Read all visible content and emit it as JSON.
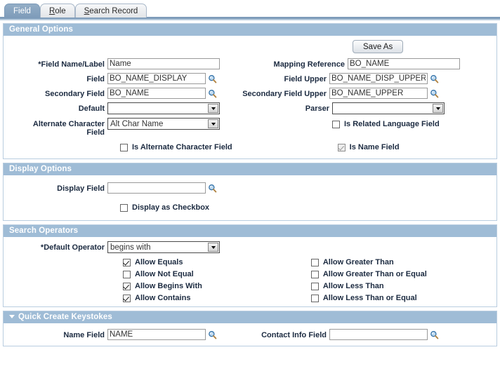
{
  "tabs": [
    {
      "label": "Field",
      "accesskey": "",
      "active": true
    },
    {
      "label": "Role",
      "accesskey": "R",
      "active": false
    },
    {
      "label": "Search Record",
      "accesskey": "S",
      "active": false
    }
  ],
  "general_options": {
    "title": "General Options",
    "save_as_button": "Save As",
    "left": {
      "field_name_label": {
        "label": "*Field Name/Label",
        "value": "Name"
      },
      "field": {
        "label": "Field",
        "value": "BO_NAME_DISPLAY",
        "icon": "magnifier-icon"
      },
      "secondary_field": {
        "label": "Secondary Field",
        "value": "BO_NAME",
        "icon": "magnifier-icon"
      },
      "default": {
        "label": "Default",
        "value": ""
      },
      "alternate_character_field": {
        "label_line1": "Alternate Character",
        "label_line2": "Field",
        "value": "Alt Char Name"
      },
      "is_alternate_character_field": {
        "label": "Is Alternate Character Field",
        "checked": false,
        "disabled": false
      }
    },
    "right": {
      "mapping_reference": {
        "label": "Mapping Reference",
        "value": "BO_NAME"
      },
      "field_upper": {
        "label": "Field Upper",
        "value": "BO_NAME_DISP_UPPER",
        "icon": "magnifier-icon"
      },
      "secondary_field_upper": {
        "label": "Secondary Field Upper",
        "value": "BO_NAME_UPPER",
        "icon": "magnifier-icon"
      },
      "parser": {
        "label": "Parser",
        "value": ""
      },
      "is_related_language_field": {
        "label": "Is Related Language Field",
        "checked": false,
        "disabled": false
      },
      "is_name_field": {
        "label": "Is Name Field",
        "checked": true,
        "disabled": true
      }
    }
  },
  "display_options": {
    "title": "Display Options",
    "display_field": {
      "label": "Display Field",
      "value": "",
      "icon": "magnifier-icon"
    },
    "display_as_checkbox": {
      "label": "Display as Checkbox",
      "checked": false
    }
  },
  "search_operators": {
    "title": "Search Operators",
    "default_operator": {
      "label": "*Default Operator",
      "value": "begins with"
    },
    "left_checkboxes": [
      {
        "label": "Allow Equals",
        "checked": true
      },
      {
        "label": "Allow Not Equal",
        "checked": false
      },
      {
        "label": "Allow Begins With",
        "checked": true
      },
      {
        "label": "Allow Contains",
        "checked": true
      }
    ],
    "right_checkboxes": [
      {
        "label": "Allow Greater Than",
        "checked": false
      },
      {
        "label": "Allow Greater Than or Equal",
        "checked": false
      },
      {
        "label": "Allow Less Than",
        "checked": false
      },
      {
        "label": "Allow Less Than or Equal",
        "checked": false
      }
    ]
  },
  "quick_create": {
    "title": "Quick Create Keystokes",
    "collapse_icon": "triangle-down-icon",
    "name_field": {
      "label": "Name Field",
      "value": "NAME",
      "icon": "magnifier-icon"
    },
    "contact_info_field": {
      "label": "Contact Info Field",
      "value": "",
      "icon": "magnifier-icon"
    }
  },
  "colors": {
    "section_header_bg": "#9fbcd6",
    "active_tab_bg": "#7e9cba",
    "section_border": "#b9cde0",
    "rule": "#7e9cba"
  }
}
